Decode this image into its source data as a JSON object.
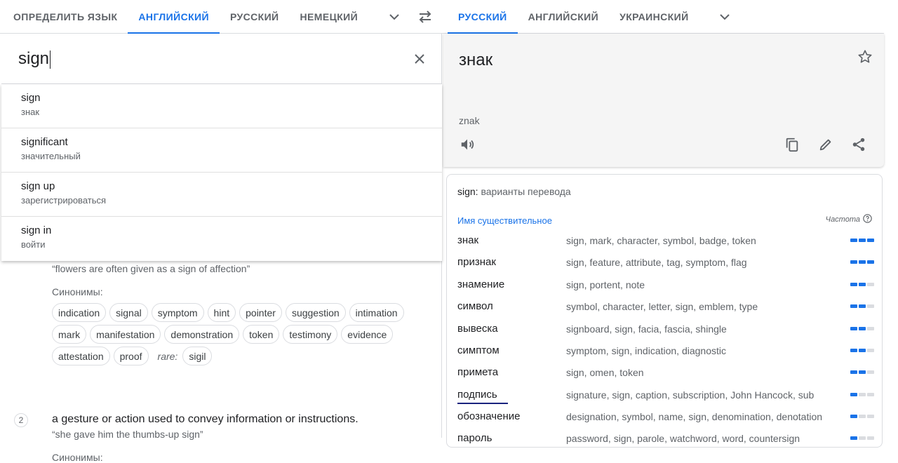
{
  "source_langs": [
    "ОПРЕДЕЛИТЬ ЯЗЫК",
    "АНГЛИЙСКИЙ",
    "РУССКИЙ",
    "НЕМЕЦКИЙ"
  ],
  "target_langs": [
    "РУССКИЙ",
    "АНГЛИЙСКИЙ",
    "УКРАИНСКИЙ"
  ],
  "source_text": "sign",
  "suggestions": [
    {
      "src": "sign",
      "tr": "знак"
    },
    {
      "src": "significant",
      "tr": "значительный"
    },
    {
      "src": "sign up",
      "tr": "зарегистрироваться"
    },
    {
      "src": "sign in",
      "tr": "войти"
    }
  ],
  "definitions": {
    "example1": "“flowers are often given as a sign of affection”",
    "synonyms_label": "Синонимы:",
    "synonyms1": [
      "indication",
      "signal",
      "symptom",
      "hint",
      "pointer",
      "suggestion",
      "intimation",
      "mark",
      "manifestation",
      "demonstration",
      "token",
      "testimony",
      "evidence",
      "attestation",
      "proof"
    ],
    "rare_label": "rare:",
    "rare1": "sigil",
    "num2": "2",
    "def2": "a gesture or action used to convey information or instructions.",
    "example2": "“she gave him the thumbs-up sign”",
    "synonyms_label2": "Синонимы:"
  },
  "target_text": "знак",
  "transliteration": "znak",
  "variants": {
    "title_word": "sign:",
    "title_rest": " варианты перевода",
    "pos": "Имя существительное",
    "freq_label": "Частота",
    "rows": [
      {
        "word": "знак",
        "syn": "sign, mark, character, symbol, badge, token",
        "freq": 3
      },
      {
        "word": "признак",
        "syn": "sign, feature, attribute, tag, symptom, flag",
        "freq": 3
      },
      {
        "word": "знамение",
        "syn": "sign, portent, note",
        "freq": 2
      },
      {
        "word": "символ",
        "syn": "symbol, character, letter, sign, emblem, type",
        "freq": 2
      },
      {
        "word": "вывеска",
        "syn": "signboard, sign, facia, fascia, shingle",
        "freq": 2
      },
      {
        "word": "симптом",
        "syn": "symptom, sign, indication, diagnostic",
        "freq": 2
      },
      {
        "word": "примета",
        "syn": "sign, omen, token",
        "freq": 2
      },
      {
        "word": "подпись",
        "syn": "signature, sign, caption, subscription, John Hancock, sub",
        "freq": 1
      },
      {
        "word": "обозначение",
        "syn": "designation, symbol, name, sign, denomination, denotation",
        "freq": 1
      },
      {
        "word": "пароль",
        "syn": "password, sign, parole, watchword, word, countersign",
        "freq": 1
      }
    ]
  },
  "colors": {
    "accent": "#1a73e8",
    "muted": "#5f6368"
  }
}
